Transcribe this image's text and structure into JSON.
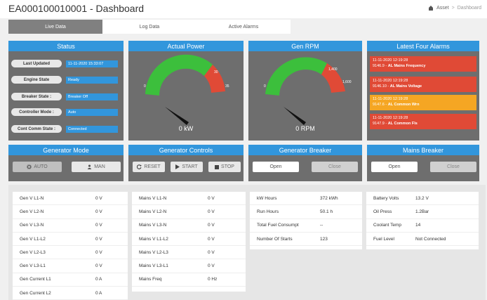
{
  "header": {
    "title": "EA000100010001 - Dashboard",
    "breadcrumb": {
      "asset": "Asset",
      "separator": ">",
      "current": "Dashboard"
    }
  },
  "tabs": [
    {
      "label": "Live Data",
      "active": true
    },
    {
      "label": "Log Data",
      "active": false
    },
    {
      "label": "Active Alarms",
      "active": false
    }
  ],
  "status": {
    "title": "Status",
    "rows": [
      {
        "label": "Last Updated",
        "value": "11-11-2020 15:33:07"
      },
      {
        "label": "Engine State",
        "value": "Ready"
      },
      {
        "label": "Breaker State :",
        "value": "Breaker Off"
      },
      {
        "label": "Controller Mode :",
        "value": "Auto"
      },
      {
        "label": "Cont Comm State :",
        "value": "Connected"
      }
    ]
  },
  "power": {
    "title": "Actual Power",
    "value": "0 kW",
    "tick_min": "0",
    "tick_a": "30",
    "tick_b": "35"
  },
  "rpm": {
    "title": "Gen RPM",
    "value": "0 RPM",
    "tick_min": "0",
    "tick_a": "1,400",
    "tick_b": "1,600"
  },
  "alarms": {
    "title": "Latest Four Alarms",
    "items": [
      {
        "time": "11-11-2020 12:19:28",
        "code": "9146.9",
        "text": "AL Mains Frequency",
        "color": "#e04a36"
      },
      {
        "time": "11-11-2020 12:19:28",
        "code": "9146.10",
        "text": "AL Mains Voltage",
        "color": "#e04a36"
      },
      {
        "time": "11-11-2020 12:19:28",
        "code": "9147.6",
        "text": "AL Common Wrn",
        "color": "#f5a623"
      },
      {
        "time": "11-11-2020 12:19:28",
        "code": "9147.9",
        "text": "AL Common Fls",
        "color": "#e04a36"
      }
    ]
  },
  "gen_mode": {
    "title": "Generator Mode",
    "auto": "AUTO",
    "man": "MAN"
  },
  "gen_controls": {
    "title": "Generator Controls",
    "reset": "RESET",
    "start": "START",
    "stop": "STOP"
  },
  "gen_breaker": {
    "title": "Generator Breaker",
    "open": "Open",
    "close": "Close"
  },
  "mains_breaker": {
    "title": "Mains Breaker",
    "open": "Open",
    "close": "Close"
  },
  "tables": {
    "gen": [
      {
        "k": "Gen V L1-N",
        "v": "0 V"
      },
      {
        "k": "Gen V L2-N",
        "v": "0 V"
      },
      {
        "k": "Gen V L3-N",
        "v": "0 V"
      },
      {
        "k": "Gen V L1-L2",
        "v": "0 V"
      },
      {
        "k": "Gen V L2-L3",
        "v": "0 V"
      },
      {
        "k": "Gen V L3-L1",
        "v": "0 V"
      },
      {
        "k": "Gen Current L1",
        "v": "0 A"
      },
      {
        "k": "Gen Current L2",
        "v": "0 A"
      }
    ],
    "mains": [
      {
        "k": "Mains V L1-N",
        "v": "0 V"
      },
      {
        "k": "Mains V L2-N",
        "v": "0 V"
      },
      {
        "k": "Mains V L3-N",
        "v": "0 V"
      },
      {
        "k": "Mains V L1-L2",
        "v": "0 V"
      },
      {
        "k": "Mains V L2-L3",
        "v": "0 V"
      },
      {
        "k": "Mains V L3-L1",
        "v": "0 V"
      },
      {
        "k": "Mains Freq",
        "v": "0 Hz"
      }
    ],
    "energy": [
      {
        "k": "kW Hours",
        "v": "372 kWh"
      },
      {
        "k": "Run Hours",
        "v": "50.1 h"
      },
      {
        "k": "Total Fuel Consumpt",
        "v": "--"
      },
      {
        "k": "Number Of Starts",
        "v": "123"
      }
    ],
    "engine": [
      {
        "k": "Battery Volts",
        "v": "13.2 V"
      },
      {
        "k": "Oil Press",
        "v": "1.2Bar"
      },
      {
        "k": "Coolant Temp",
        "v": "14"
      },
      {
        "k": "Fuel Level",
        "v": "Not Connected"
      }
    ]
  }
}
